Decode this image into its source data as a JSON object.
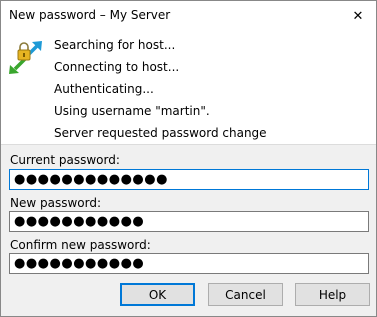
{
  "window": {
    "title": "New password – My Server",
    "close_glyph": "✕"
  },
  "status": {
    "icon": "key-exchange-icon",
    "lines": [
      "Searching for host...",
      "Connecting to host...",
      "Authenticating...",
      "Using username \"martin\".",
      "Server requested password change"
    ]
  },
  "form": {
    "current_password": {
      "label": "Current password:",
      "value": "●●●●●●●●●●●●●"
    },
    "new_password": {
      "label": "New password:",
      "value": "●●●●●●●●●●●"
    },
    "confirm_password": {
      "label": "Confirm new password:",
      "value": "●●●●●●●●●●●"
    }
  },
  "buttons": {
    "ok": "OK",
    "cancel": "Cancel",
    "help": "Help"
  },
  "colors": {
    "accent": "#0078d7",
    "arrow_blue": "#1e9ad6",
    "arrow_green": "#3aa62e",
    "lock_gold": "#e6b422"
  }
}
